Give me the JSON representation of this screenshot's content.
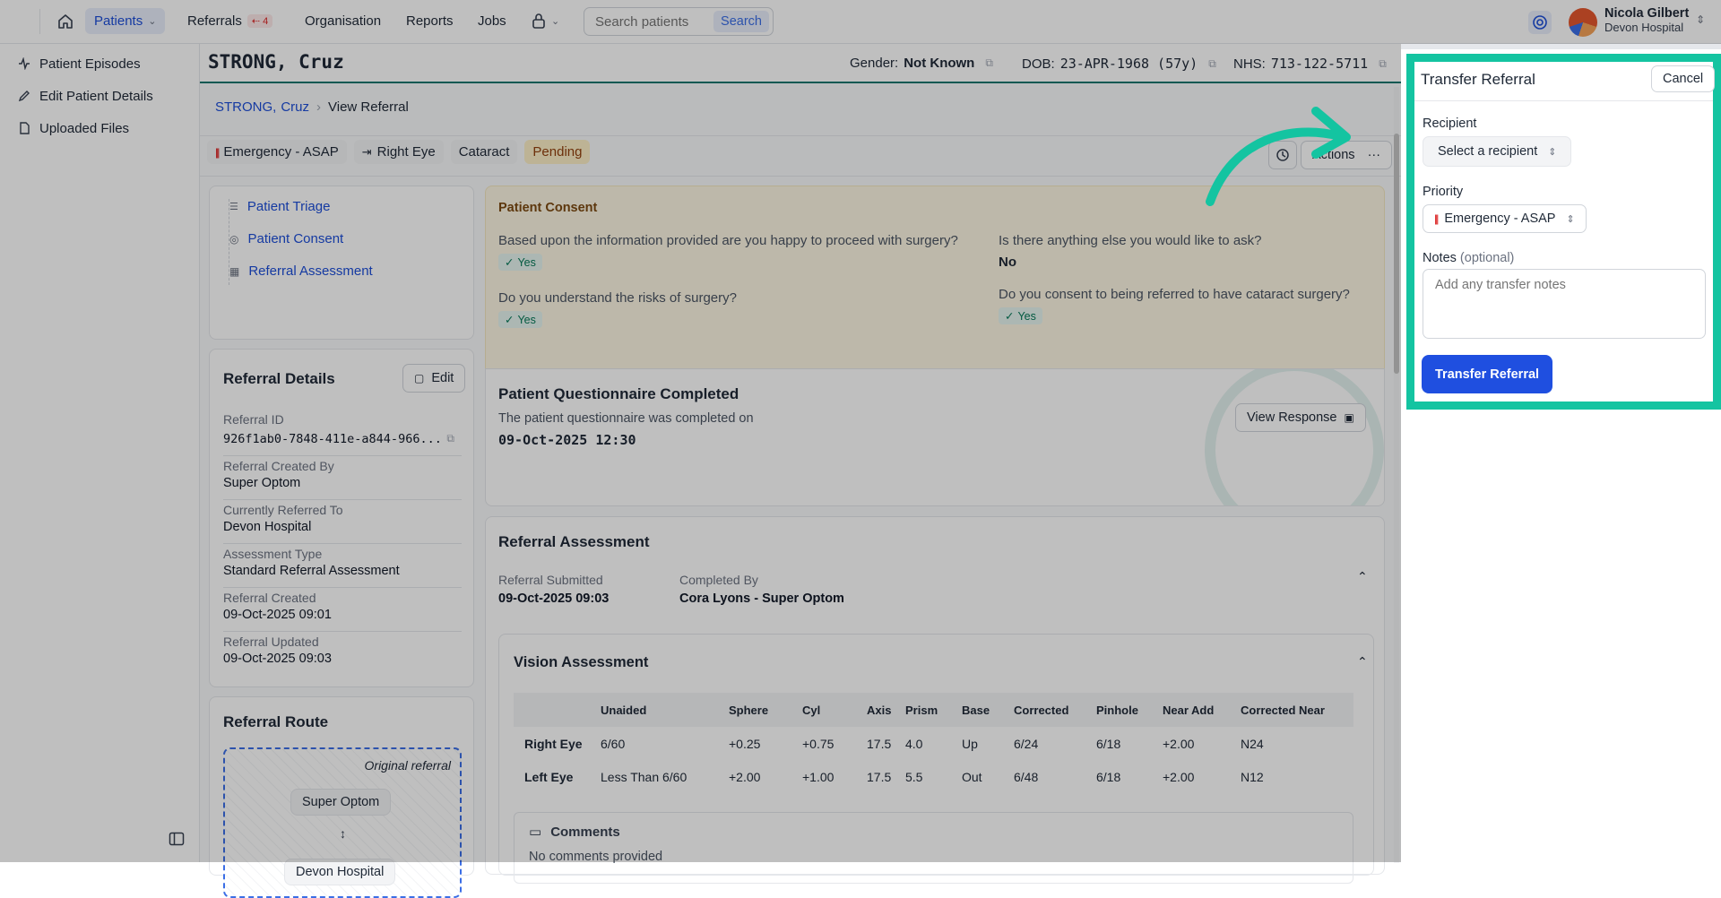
{
  "nav": {
    "patients": "Patients",
    "referrals": "Referrals",
    "referrals_badge": "4",
    "organisation": "Organisation",
    "reports": "Reports",
    "jobs": "Jobs",
    "search_placeholder": "Search patients",
    "search_button": "Search"
  },
  "user": {
    "name": "Nicola Gilbert",
    "org": "Devon Hospital"
  },
  "sidebar": {
    "items": [
      {
        "label": "Patient Episodes",
        "icon": "activity-icon"
      },
      {
        "label": "Edit Patient Details",
        "icon": "pencil-icon"
      },
      {
        "label": "Uploaded Files",
        "icon": "file-icon"
      }
    ]
  },
  "patient": {
    "name": "STRONG, Cruz",
    "gender_label": "Gender:",
    "gender": "Not Known",
    "dob_label": "DOB:",
    "dob": "23-APR-1968 (57y)",
    "nhs_label": "NHS:",
    "nhs": "713-122-5711"
  },
  "breadcrumb": {
    "surname": "STRONG,",
    "forename": "Cruz",
    "current": "View Referral"
  },
  "tags": {
    "priority": "Emergency - ASAP",
    "eye": "Right Eye",
    "condition": "Cataract",
    "status": "Pending",
    "actions": "Actions"
  },
  "sections": {
    "items": [
      "Patient Triage",
      "Patient Consent",
      "Referral Assessment"
    ]
  },
  "referral_details": {
    "title": "Referral Details",
    "edit": "Edit",
    "fields": [
      {
        "label": "Referral ID",
        "value": "926f1ab0-7848-411e-a844-966..."
      },
      {
        "label": "Referral Created By",
        "value": "Super Optom"
      },
      {
        "label": "Currently Referred To",
        "value": "Devon Hospital"
      },
      {
        "label": "Assessment Type",
        "value": "Standard Referral Assessment"
      },
      {
        "label": "Referral Created",
        "value": "09-Oct-2025 09:01"
      },
      {
        "label": "Referral Updated",
        "value": "09-Oct-2025 09:03"
      }
    ]
  },
  "route": {
    "title": "Referral Route",
    "original": "Original referral",
    "from": "Super Optom",
    "to": "Devon Hospital"
  },
  "consent": {
    "title": "Patient Consent",
    "q1": "Based upon the information provided are you happy to proceed with surgery?",
    "a1": "Yes",
    "q2": "Do you understand the risks of surgery?",
    "a2": "Yes",
    "q3": "Is there anything else you would like to ask?",
    "a3": "No",
    "q4": "Do you consent to being referred to have cataract surgery?",
    "a4": "Yes"
  },
  "questionnaire": {
    "title": "Patient Questionnaire Completed",
    "text": "The patient questionnaire was completed on",
    "date": "09-Oct-2025 12:30",
    "button": "View Response"
  },
  "assessment": {
    "title": "Referral Assessment",
    "submitted_label": "Referral Submitted",
    "submitted": "09-Oct-2025 09:03",
    "completed_label": "Completed By",
    "completed": "Cora Lyons - Super Optom"
  },
  "vision": {
    "title": "Vision Assessment",
    "headers": [
      "",
      "Unaided",
      "Sphere",
      "Cyl",
      "Axis",
      "Prism",
      "Base",
      "Corrected",
      "Pinhole",
      "Near Add",
      "Corrected Near"
    ],
    "rows": [
      [
        "Right Eye",
        "6/60",
        "+0.25",
        "+0.75",
        "17.5",
        "4.0",
        "Up",
        "6/24",
        "6/18",
        "+2.00",
        "N24"
      ],
      [
        "Left Eye",
        "Less Than 6/60",
        "+2.00",
        "+1.00",
        "17.5",
        "5.5",
        "Out",
        "6/48",
        "6/18",
        "+2.00",
        "N12"
      ]
    ],
    "comments_title": "Comments",
    "comments": "No comments provided"
  },
  "transfer": {
    "title": "Transfer Referral",
    "cancel": "Cancel",
    "recipient_label": "Recipient",
    "recipient_placeholder": "Select a recipient",
    "priority_label": "Priority",
    "priority_value": "Emergency - ASAP",
    "notes_label": "Notes",
    "notes_optional": "(optional)",
    "notes_placeholder": "Add any transfer notes",
    "submit": "Transfer Referral"
  },
  "colors": {
    "accent": "#1d4ed8",
    "highlight": "#14c4a1",
    "submit": "#1f4fe0",
    "pending": "#fcefc7",
    "consent_bg": "#fdf6e3"
  }
}
